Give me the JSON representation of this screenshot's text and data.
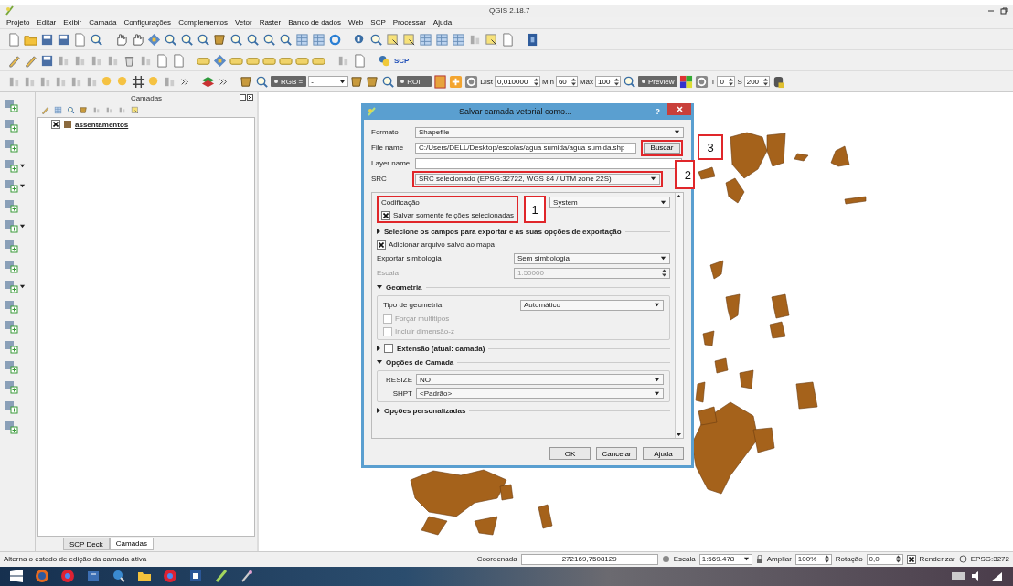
{
  "window": {
    "title": "QGIS 2.18.7"
  },
  "menu": [
    "Projeto",
    "Editar",
    "Exibir",
    "Camada",
    "Configurações",
    "Complementos",
    "Vetor",
    "Raster",
    "Banco de dados",
    "Web",
    "SCP",
    "Processar",
    "Ajuda"
  ],
  "plugin_logo": "SCP",
  "scp_toolbar": {
    "rgb_label": "RGB =",
    "rgb_value": "-",
    "roi_label": "ROI",
    "dist_label": "Dist",
    "dist_value": "0,010000",
    "min_label": "Min",
    "min_value": "60",
    "max_label": "Max",
    "max_value": "100",
    "preview_label": "Preview",
    "t_label": "T",
    "t_value": "0",
    "s_label": "S",
    "s_value": "200"
  },
  "layers_panel": {
    "title": "Camadas",
    "layers": [
      {
        "name": "assentamentos",
        "visible": true
      }
    ]
  },
  "dock_tabs": [
    {
      "label": "SCP Deck",
      "selected": false
    },
    {
      "label": "Camadas",
      "selected": true
    }
  ],
  "dialog": {
    "title": "Salvar camada vetorial como...",
    "help": "?",
    "format": {
      "label": "Formato",
      "value": "Shapefile"
    },
    "file_name": {
      "label": "File name",
      "value": "C:/Users/DELL/Desktop/escolas/agua sumida/agua sumida.shp",
      "button": "Buscar"
    },
    "layer_name": {
      "label": "Layer name"
    },
    "crs": {
      "label": "SRC",
      "value": "SRC selecionado (EPSG:32722, WGS 84 / UTM zone 22S)"
    },
    "encoding": {
      "label": "Codificação",
      "value": "System"
    },
    "save_selected": {
      "label": "Salvar somente feições selecionadas",
      "checked": true
    },
    "fields_section": {
      "title": "Selecione os campos para exportar e as suas opções de exportação",
      "expanded": false
    },
    "add_to_map": {
      "label": "Adicionar arquivo salvo ao mapa",
      "checked": true
    },
    "symbology": {
      "label": "Exportar simbologia",
      "value": "Sem simbologia"
    },
    "scale": {
      "label": "Escala",
      "value": "1:50000",
      "disabled": true
    },
    "geometry": {
      "title": "Geometria",
      "expanded": true,
      "type_label": "Tipo de geometria",
      "type_value": "Automático",
      "options": [
        {
          "label": "Forçar multitipos",
          "checked": false,
          "disabled": true
        },
        {
          "label": "Incluir dimensão-z",
          "checked": false,
          "disabled": true
        }
      ]
    },
    "extent": {
      "title": "Extensão (atual: camada)",
      "expanded": false,
      "checked": false
    },
    "layer_options": {
      "title": "Opções de Camada",
      "expanded": true,
      "options": [
        {
          "label": "RESIZE",
          "value": "NO"
        },
        {
          "label": "SHPT",
          "value": "<Padrão>"
        }
      ]
    },
    "custom_options": {
      "title": "Opções personalizadas",
      "expanded": false
    },
    "buttons": [
      "OK",
      "Cancelar",
      "Ajuda"
    ]
  },
  "callouts": [
    {
      "label": "1"
    },
    {
      "label": "2"
    },
    {
      "label": "3"
    }
  ],
  "status_bar": {
    "message": "Alterna o estado de edição da camada ativa",
    "coord_label": "Coordenada",
    "coord_value": "272169,7508129",
    "scale_label": "Escala",
    "scale_value": "1:569.478",
    "zoom_label": "Ampliar",
    "zoom_value": "100%",
    "rotation_label": "Rotação",
    "rotation_value": "0,0",
    "render_label": "Renderizar",
    "render_checked": true,
    "crs": "EPSG:3272"
  }
}
